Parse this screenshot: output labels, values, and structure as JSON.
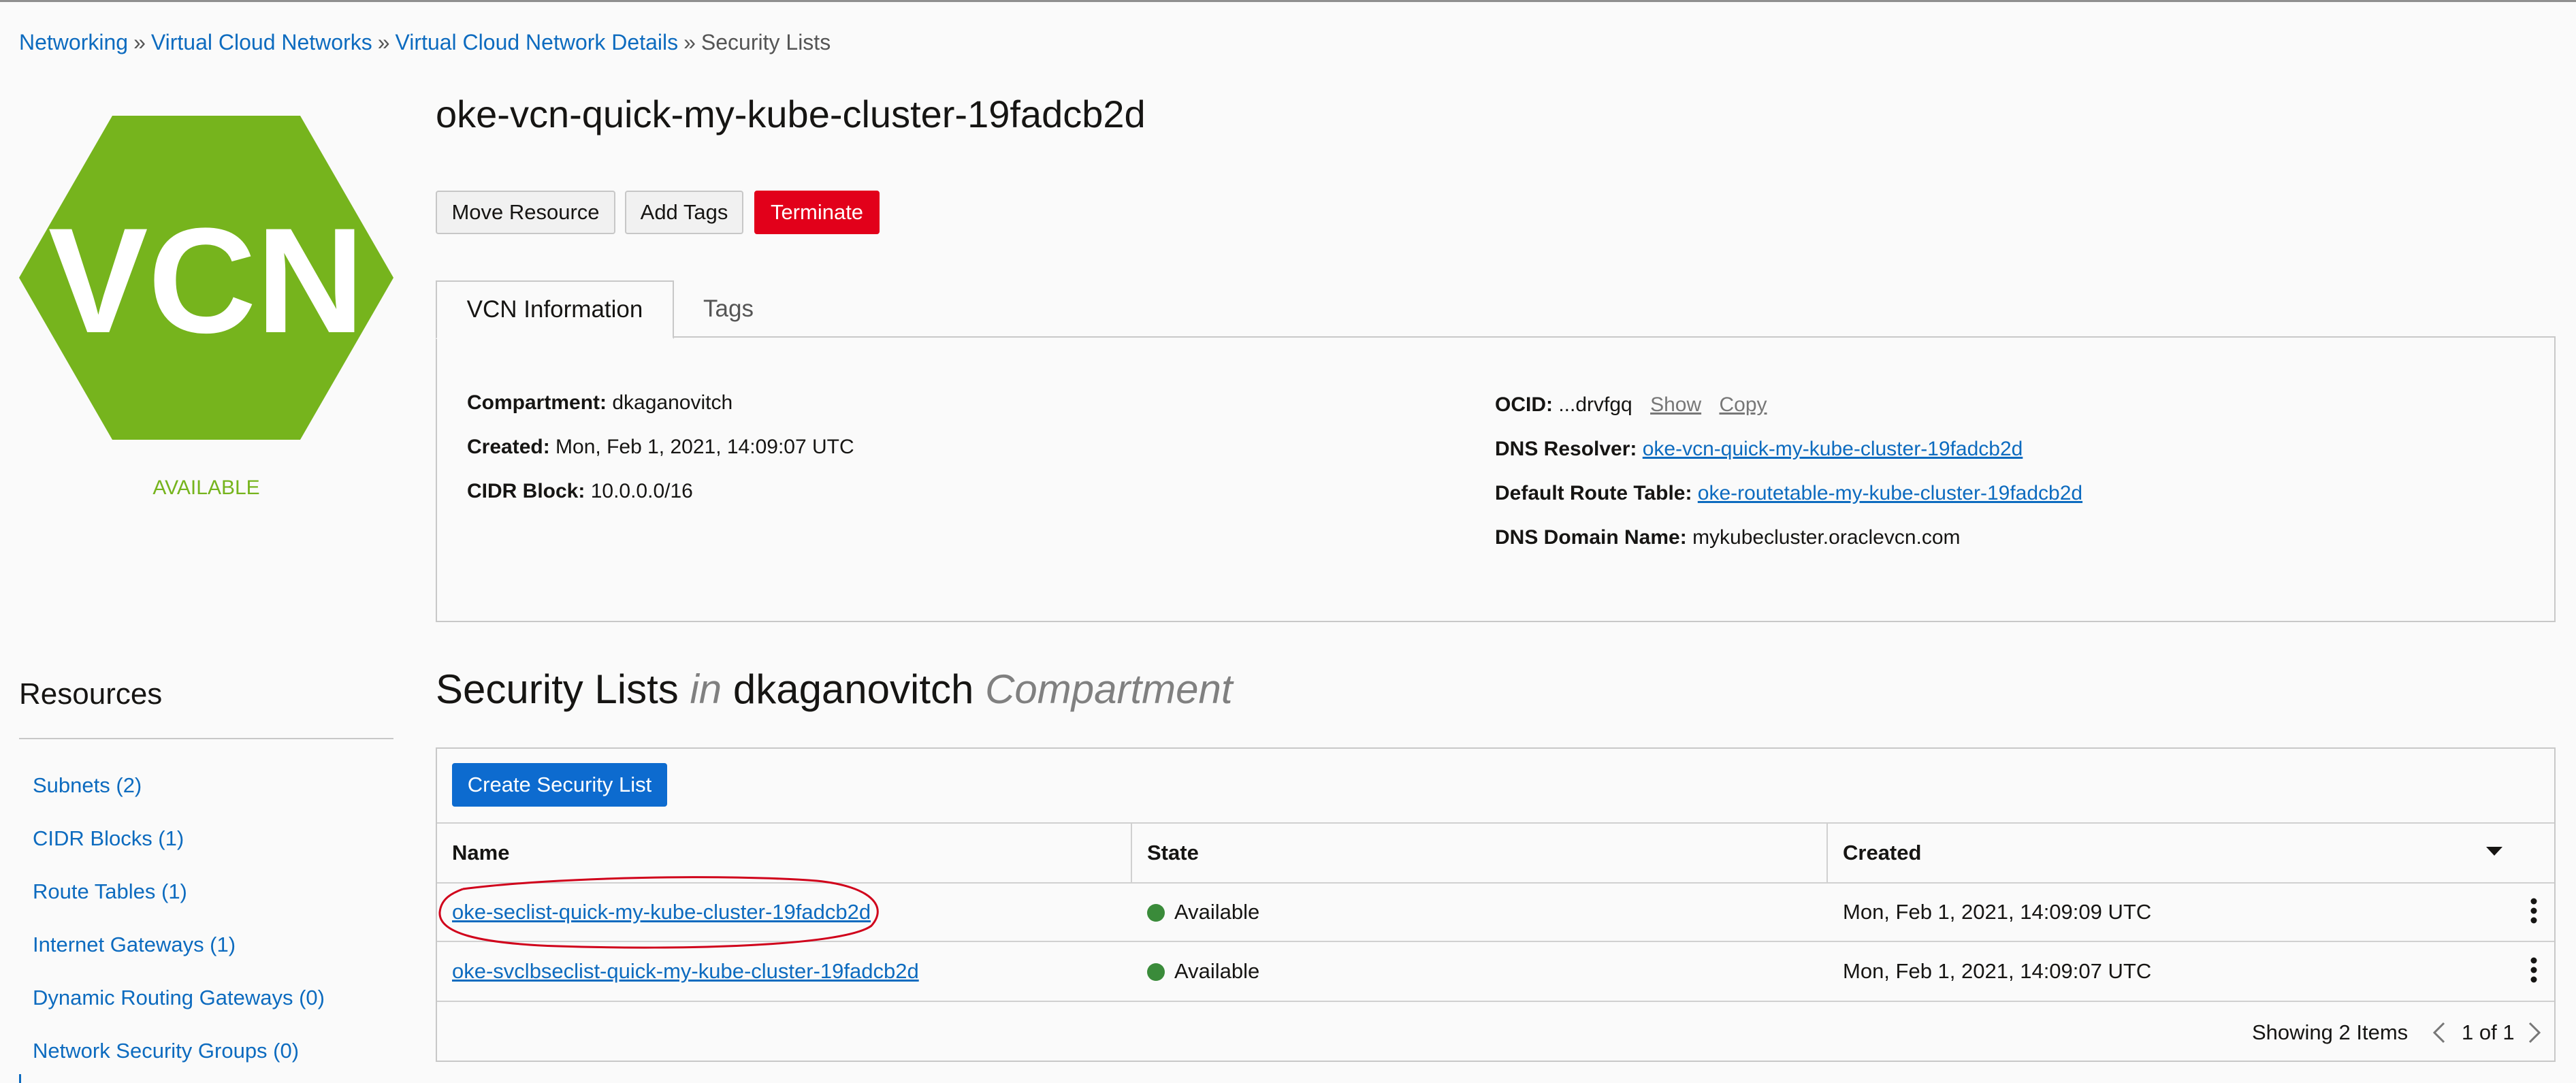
{
  "breadcrumb": {
    "items": [
      "Networking",
      "Virtual Cloud Networks",
      "Virtual Cloud Network Details"
    ],
    "separator": "»",
    "current": "Security Lists"
  },
  "resource": {
    "icon_text": "VCN",
    "status": "AVAILABLE",
    "icon_color": "#76b41d",
    "title": "oke-vcn-quick-my-kube-cluster-19fadcb2d"
  },
  "actions": {
    "move_label": "Move Resource",
    "tags_label": "Add Tags",
    "terminate_label": "Terminate"
  },
  "tabs": [
    {
      "label": "VCN Information",
      "active": true
    },
    {
      "label": "Tags",
      "active": false
    }
  ],
  "info": {
    "compartment_label": "Compartment:",
    "compartment_value": "dkaganovitch",
    "created_label": "Created:",
    "created_value": "Mon, Feb 1, 2021, 14:09:07 UTC",
    "cidr_label": "CIDR Block:",
    "cidr_value": "10.0.0.0/16",
    "ocid_label": "OCID:",
    "ocid_value": "...drvfgq",
    "show_label": "Show",
    "copy_label": "Copy",
    "dns_resolver_label": "DNS Resolver:",
    "dns_resolver_value": "oke-vcn-quick-my-kube-cluster-19fadcb2d",
    "route_table_label": "Default Route Table:",
    "route_table_value": "oke-routetable-my-kube-cluster-19fadcb2d",
    "dns_domain_label": "DNS Domain Name:",
    "dns_domain_value": "mykubecluster.oraclevcn.com"
  },
  "resources": {
    "title": "Resources",
    "items": [
      "Subnets (2)",
      "CIDR Blocks (1)",
      "Route Tables (1)",
      "Internet Gateways (1)",
      "Dynamic Routing Gateways (0)",
      "Network Security Groups (0)"
    ]
  },
  "section": {
    "title": "Security Lists",
    "in_word": "in",
    "compartment": "dkaganovitch",
    "compartment_word": "Compartment"
  },
  "table": {
    "create_label": "Create Security List",
    "columns": [
      "Name",
      "State",
      "Created"
    ],
    "rows": [
      {
        "name": "oke-seclist-quick-my-kube-cluster-19fadcb2d",
        "state": "Available",
        "created": "Mon, Feb 1, 2021, 14:09:09 UTC"
      },
      {
        "name": "oke-svclbseclist-quick-my-kube-cluster-19fadcb2d",
        "state": "Available",
        "created": "Mon, Feb 1, 2021, 14:09:07 UTC"
      }
    ],
    "footer_count": "Showing 2 Items",
    "page_label": "1 of 1",
    "available_color": "#3a8b3a",
    "highlight_color": "#d0021b"
  }
}
